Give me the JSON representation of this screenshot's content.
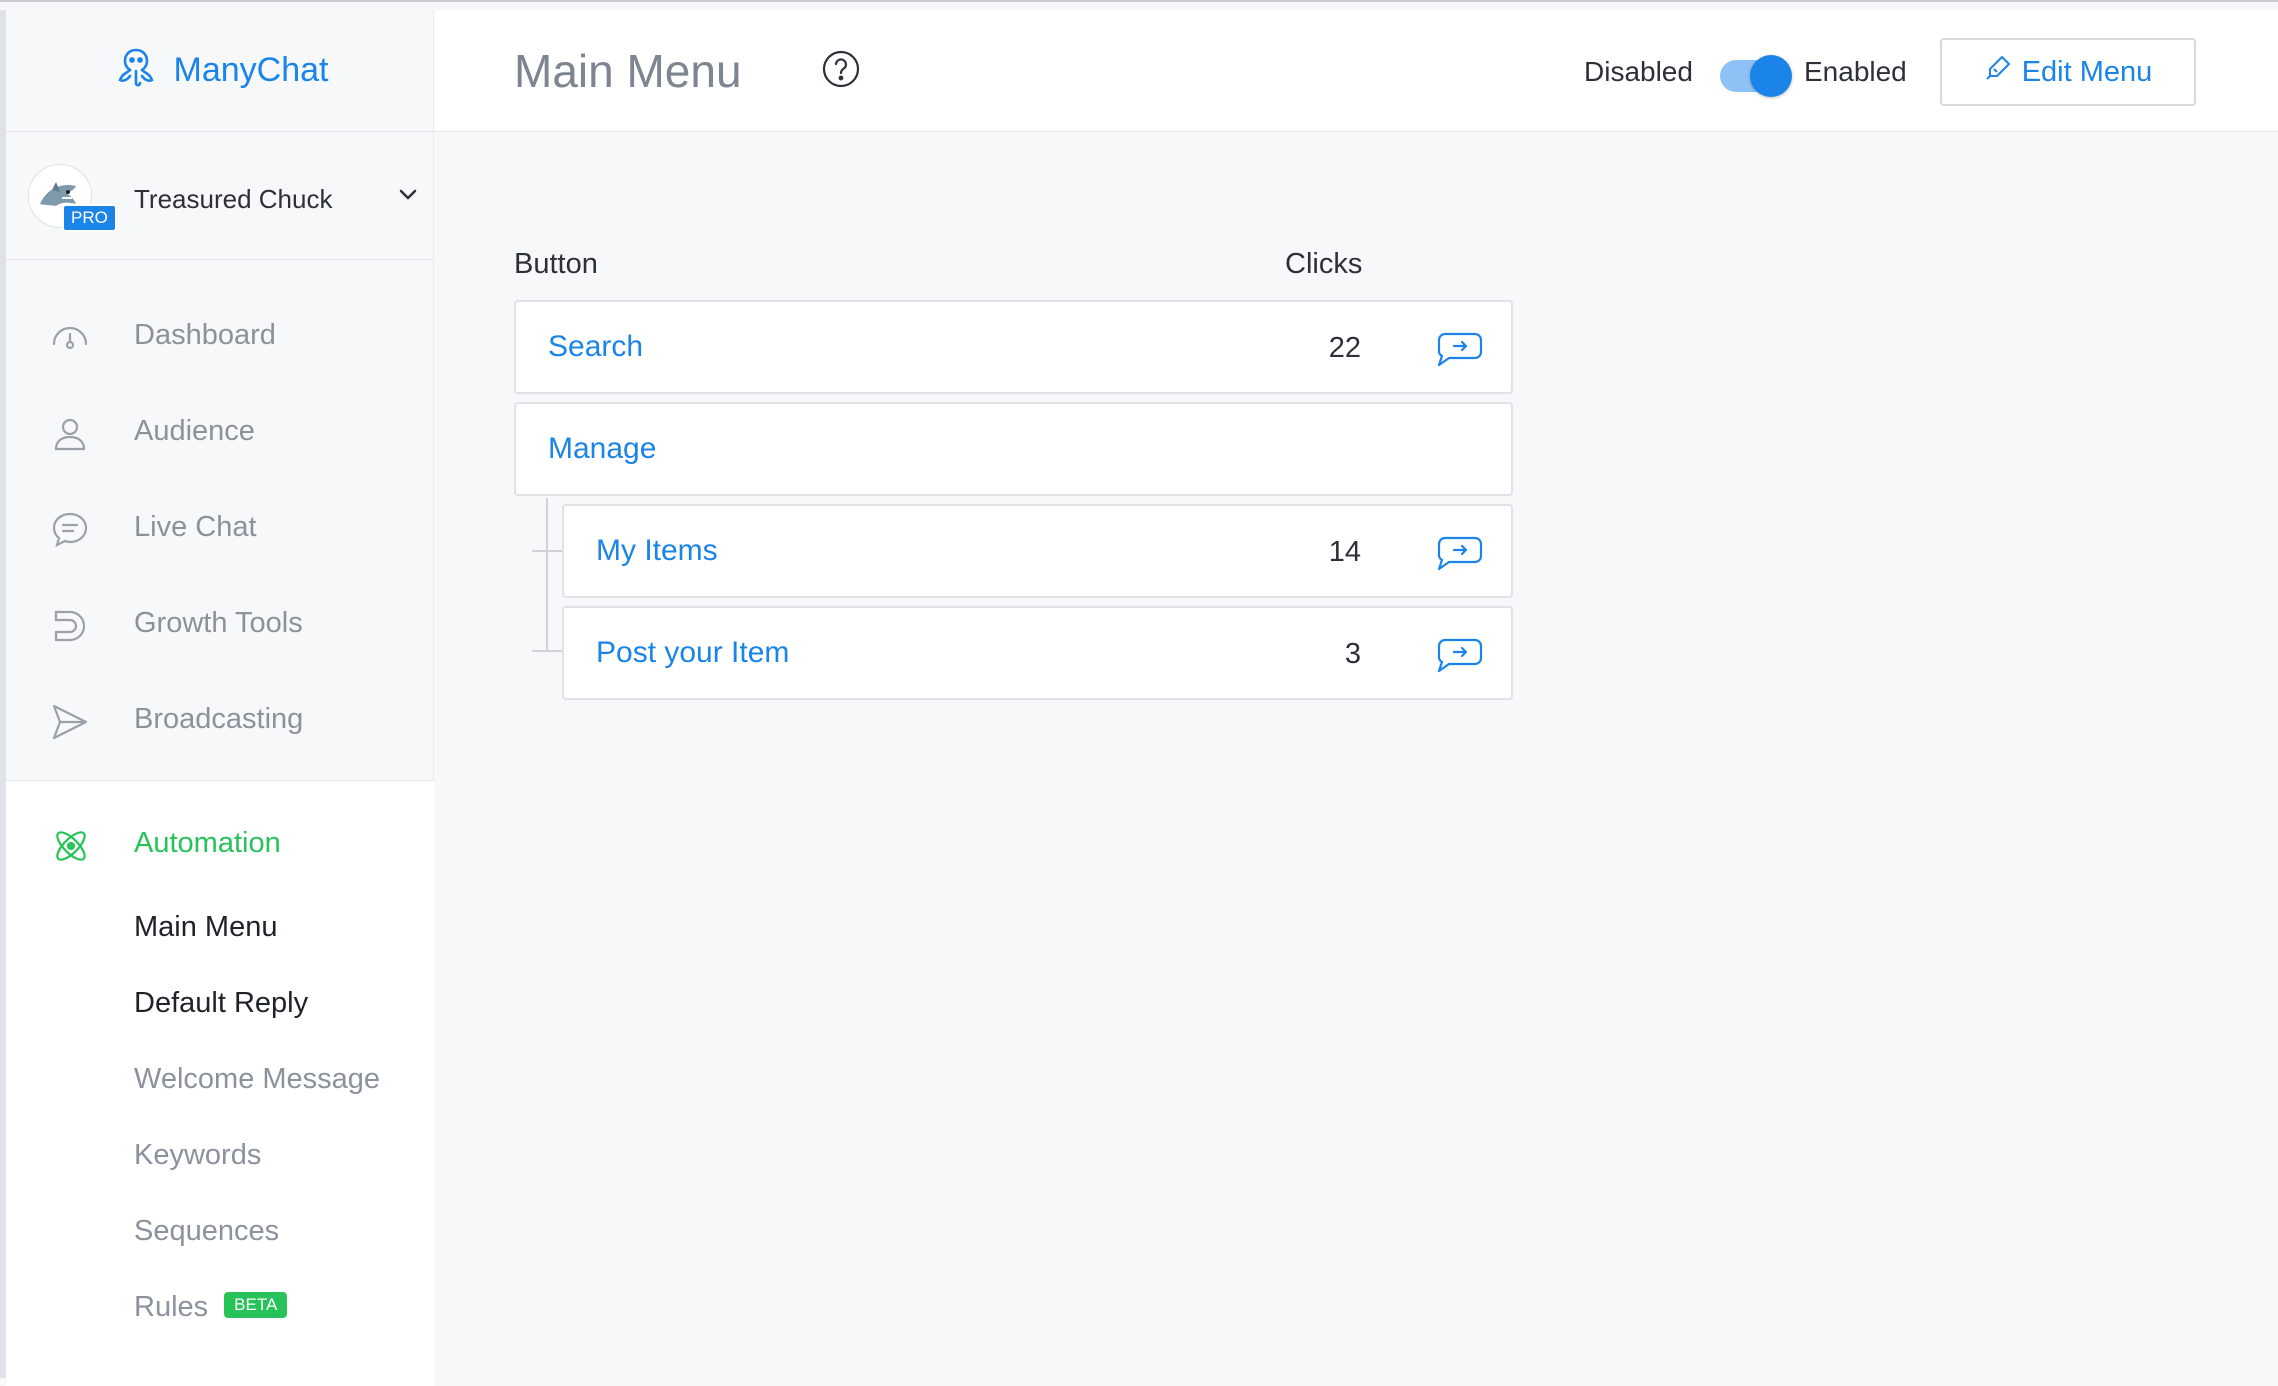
{
  "brand": {
    "name": "ManyChat"
  },
  "account": {
    "name": "Treasured Chuck",
    "badge": "PRO"
  },
  "nav": [
    {
      "label": "Dashboard",
      "icon": "dashboard-gauge-icon"
    },
    {
      "label": "Audience",
      "icon": "user-icon"
    },
    {
      "label": "Live Chat",
      "icon": "chat-bubble-icon"
    },
    {
      "label": "Growth Tools",
      "icon": "magnet-icon"
    },
    {
      "label": "Broadcasting",
      "icon": "send-icon"
    }
  ],
  "automation": {
    "label": "Automation",
    "icon": "atom-icon",
    "items": [
      {
        "label": "Main Menu"
      },
      {
        "label": "Default Reply"
      },
      {
        "label": "Welcome Message"
      },
      {
        "label": "Keywords"
      },
      {
        "label": "Sequences"
      },
      {
        "label": "Rules",
        "badge": "BETA"
      }
    ]
  },
  "header": {
    "title": "Main Menu",
    "toggle_off_label": "Disabled",
    "toggle_on_label": "Enabled",
    "toggle_state": "enabled",
    "edit_button": "Edit Menu"
  },
  "table": {
    "headers": {
      "button": "Button",
      "clicks": "Clicks"
    },
    "rows": [
      {
        "label": "Search",
        "clicks": "22",
        "level": 0
      },
      {
        "label": "Manage",
        "clicks": "",
        "level": 0
      },
      {
        "label": "My Items",
        "clicks": "14",
        "level": 1
      },
      {
        "label": "Post your Item",
        "clicks": "3",
        "level": 1
      }
    ]
  },
  "colors": {
    "accent": "#1a84e8",
    "active": "#27c35a",
    "muted_text": "#8b929c"
  }
}
